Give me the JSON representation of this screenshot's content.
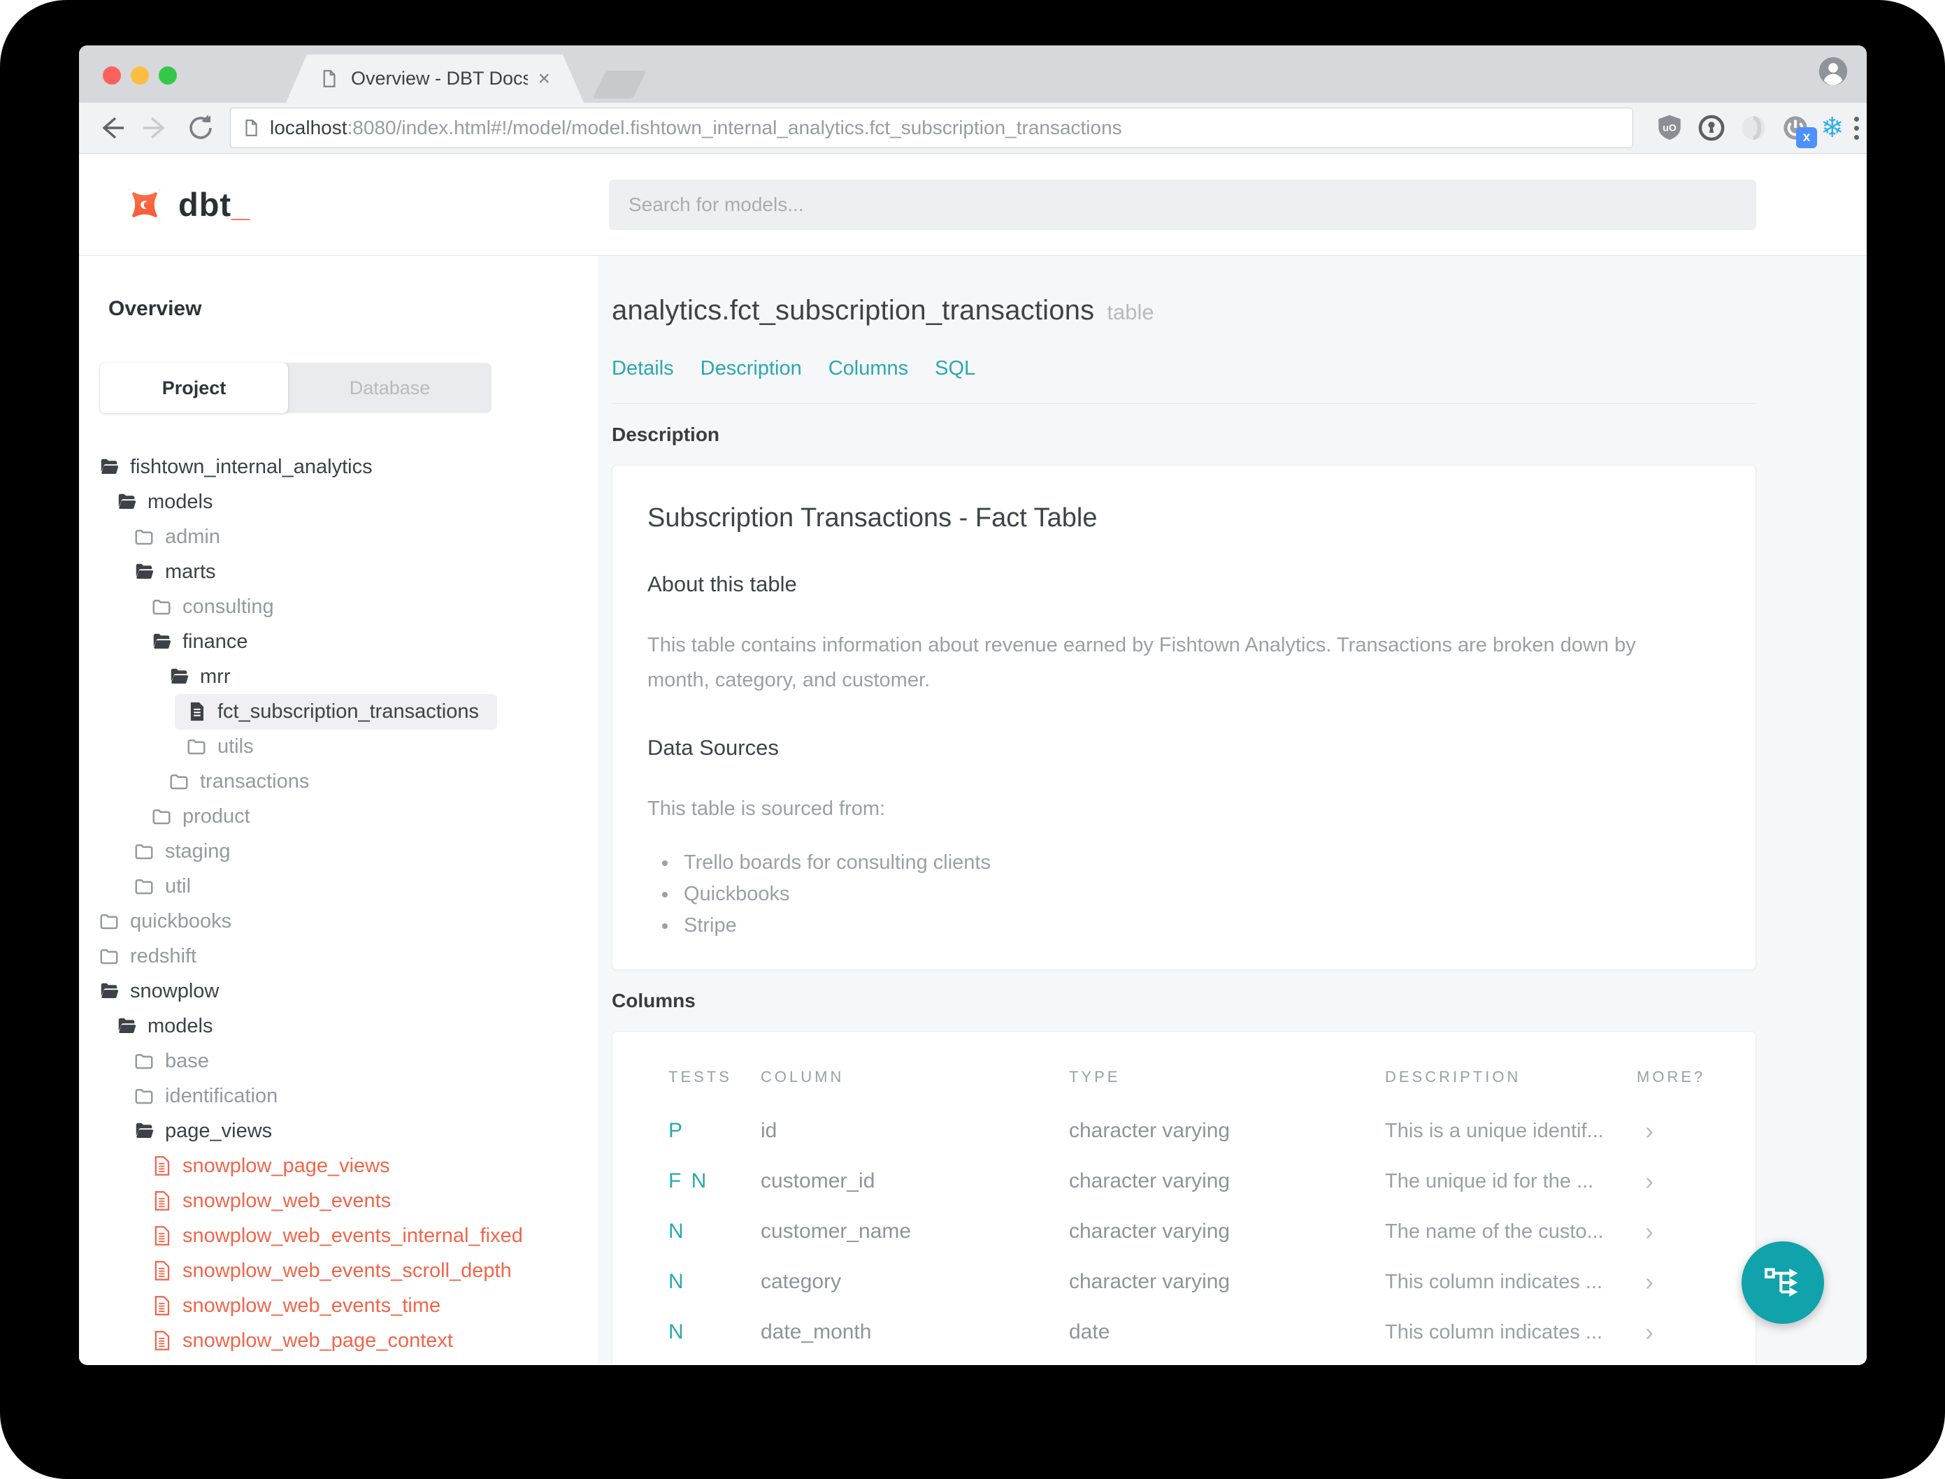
{
  "browser": {
    "tab_title": "Overview - DBT Docs",
    "url_host": "localhost",
    "url_rest": ":8080/index.html#!/model/model.fishtown_internal_analytics.fct_subscription_transactions",
    "extension_badge": "x"
  },
  "header": {
    "logo_text": "dbt",
    "logo_underscore": "_",
    "search_placeholder": "Search for models..."
  },
  "sidebar": {
    "title": "Overview",
    "tabs": [
      {
        "label": "Project",
        "active": true
      },
      {
        "label": "Database",
        "active": false
      }
    ],
    "tree": [
      {
        "label": "fishtown_internal_analytics",
        "indent": 0,
        "icon": "folder-open"
      },
      {
        "label": "models",
        "indent": 1,
        "icon": "folder-open"
      },
      {
        "label": "admin",
        "indent": 2,
        "icon": "folder-closed"
      },
      {
        "label": "marts",
        "indent": 2,
        "icon": "folder-open"
      },
      {
        "label": "consulting",
        "indent": 3,
        "icon": "folder-closed"
      },
      {
        "label": "finance",
        "indent": 3,
        "icon": "folder-open"
      },
      {
        "label": "mrr",
        "indent": 4,
        "icon": "folder-open"
      },
      {
        "label": "fct_subscription_transactions",
        "indent": 5,
        "icon": "file",
        "selected": true
      },
      {
        "label": "utils",
        "indent": 5,
        "icon": "folder-closed"
      },
      {
        "label": "transactions",
        "indent": 4,
        "icon": "folder-closed"
      },
      {
        "label": "product",
        "indent": 3,
        "icon": "folder-closed"
      },
      {
        "label": "staging",
        "indent": 2,
        "icon": "folder-closed"
      },
      {
        "label": "util",
        "indent": 2,
        "icon": "folder-closed"
      },
      {
        "label": "quickbooks",
        "indent": 0,
        "icon": "folder-closed"
      },
      {
        "label": "redshift",
        "indent": 0,
        "icon": "folder-closed"
      },
      {
        "label": "snowplow",
        "indent": 0,
        "icon": "folder-open"
      },
      {
        "label": "models",
        "indent": 1,
        "icon": "folder-open"
      },
      {
        "label": "base",
        "indent": 2,
        "icon": "folder-closed"
      },
      {
        "label": "identification",
        "indent": 2,
        "icon": "folder-closed"
      },
      {
        "label": "page_views",
        "indent": 2,
        "icon": "folder-open"
      },
      {
        "label": "snowplow_page_views",
        "indent": 3,
        "icon": "file-red"
      },
      {
        "label": "snowplow_web_events",
        "indent": 3,
        "icon": "file-red"
      },
      {
        "label": "snowplow_web_events_internal_fixed",
        "indent": 3,
        "icon": "file-red"
      },
      {
        "label": "snowplow_web_events_scroll_depth",
        "indent": 3,
        "icon": "file-red"
      },
      {
        "label": "snowplow_web_events_time",
        "indent": 3,
        "icon": "file-red"
      },
      {
        "label": "snowplow_web_page_context",
        "indent": 3,
        "icon": "file-red"
      }
    ]
  },
  "main": {
    "title": "analytics.fct_subscription_transactions",
    "title_badge": "table",
    "nav": [
      "Details",
      "Description",
      "Columns",
      "SQL"
    ],
    "description_heading": "Description",
    "description_card": {
      "title": "Subscription Transactions - Fact Table",
      "about_heading": "About this table",
      "about_text": "This table contains information about revenue earned by Fishtown Analytics. Transactions are broken down by month, category, and customer.",
      "sources_heading": "Data Sources",
      "sources_intro": "This table is sourced from:",
      "sources": [
        "Trello boards for consulting clients",
        "Quickbooks",
        "Stripe"
      ]
    },
    "columns_heading": "Columns",
    "columns_table": {
      "headers": [
        "TESTS",
        "COLUMN",
        "TYPE",
        "DESCRIPTION",
        "MORE?"
      ],
      "rows": [
        {
          "tests": "P",
          "column": "id",
          "type": "character varying",
          "description": "This is a unique identif...",
          "more": "›"
        },
        {
          "tests": "F N",
          "column": "customer_id",
          "type": "character varying",
          "description": "The unique id for the ...",
          "more": "›"
        },
        {
          "tests": "N",
          "column": "customer_name",
          "type": "character varying",
          "description": "The name of the custo...",
          "more": "›"
        },
        {
          "tests": "N",
          "column": "category",
          "type": "character varying",
          "description": "This column indicates ...",
          "more": "›"
        },
        {
          "tests": "N",
          "column": "date_month",
          "type": "date",
          "description": "This column indicates ...",
          "more": "›"
        }
      ]
    }
  },
  "colors": {
    "accent_teal": "#2aa8b2",
    "fab_teal": "#10a3ab",
    "model_red": "#f0664a",
    "logo_orange": "#ff6a4d",
    "tree_dark": "#3d4247",
    "tree_gray": "#9599a0",
    "main_bg": "#f6f7f9"
  }
}
